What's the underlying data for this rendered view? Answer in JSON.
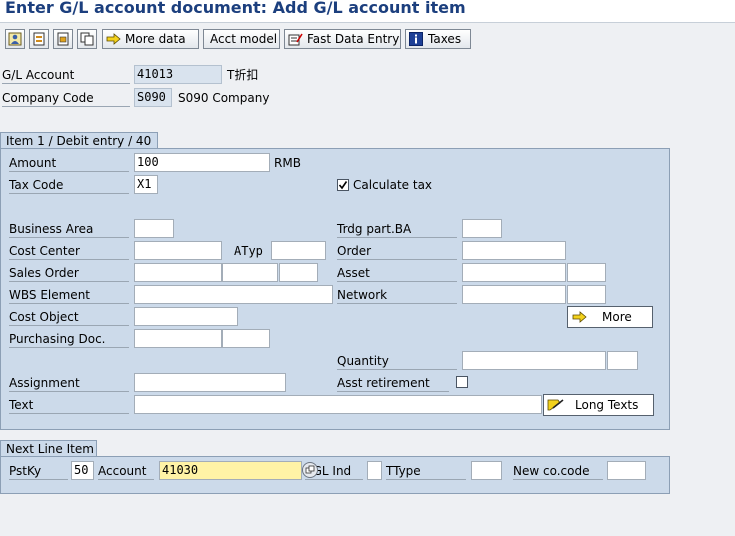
{
  "window": {
    "title": "Enter G/L account document: Add G/L account item"
  },
  "toolbar": {
    "icons": [
      "person-icon",
      "overview-icon",
      "document-icon",
      "copy-icon"
    ],
    "more_data_label": "More data",
    "acct_model_label": "Acct model",
    "fast_data_entry_label": "Fast Data Entry",
    "taxes_label": "Taxes"
  },
  "header": {
    "gl_account_label": "G/L Account",
    "gl_account_value": "41013",
    "gl_account_text": "T折扣",
    "company_code_label": "Company Code",
    "company_code_value": "S090",
    "company_code_text": "S090 Company"
  },
  "item": {
    "tab_label": "Item 1 / Debit entry / 40",
    "amount_label": "Amount",
    "amount_value": "100",
    "currency": "RMB",
    "tax_code_label": "Tax Code",
    "tax_code_value": "X1",
    "calculate_tax_label": "Calculate tax",
    "calculate_tax_checked": true,
    "business_area_label": "Business Area",
    "trdg_part_ba_label": "Trdg part.BA",
    "cost_center_label": "Cost Center",
    "atyp_label": "ATyp",
    "order_label": "Order",
    "sales_order_label": "Sales Order",
    "asset_label": "Asset",
    "wbs_element_label": "WBS Element",
    "network_label": "Network",
    "cost_object_label": "Cost Object",
    "more_label": "More",
    "purchasing_doc_label": "Purchasing Doc.",
    "quantity_label": "Quantity",
    "assignment_label": "Assignment",
    "asst_retirement_label": "Asst retirement",
    "asst_retirement_checked": false,
    "text_label": "Text",
    "long_texts_label": "Long Texts"
  },
  "next_line": {
    "tab_label": "Next Line Item",
    "pstky_label": "PstKy",
    "pstky_value": "50",
    "account_label": "Account",
    "account_value": "41030",
    "sgl_ind_label": "SGL Ind",
    "ttype_label": "TType",
    "new_cocode_label": "New co.code"
  },
  "colors": {
    "title": "#1c3f7e",
    "group_bg": "#ccdaea",
    "highlight_field": "#fff3a6"
  }
}
